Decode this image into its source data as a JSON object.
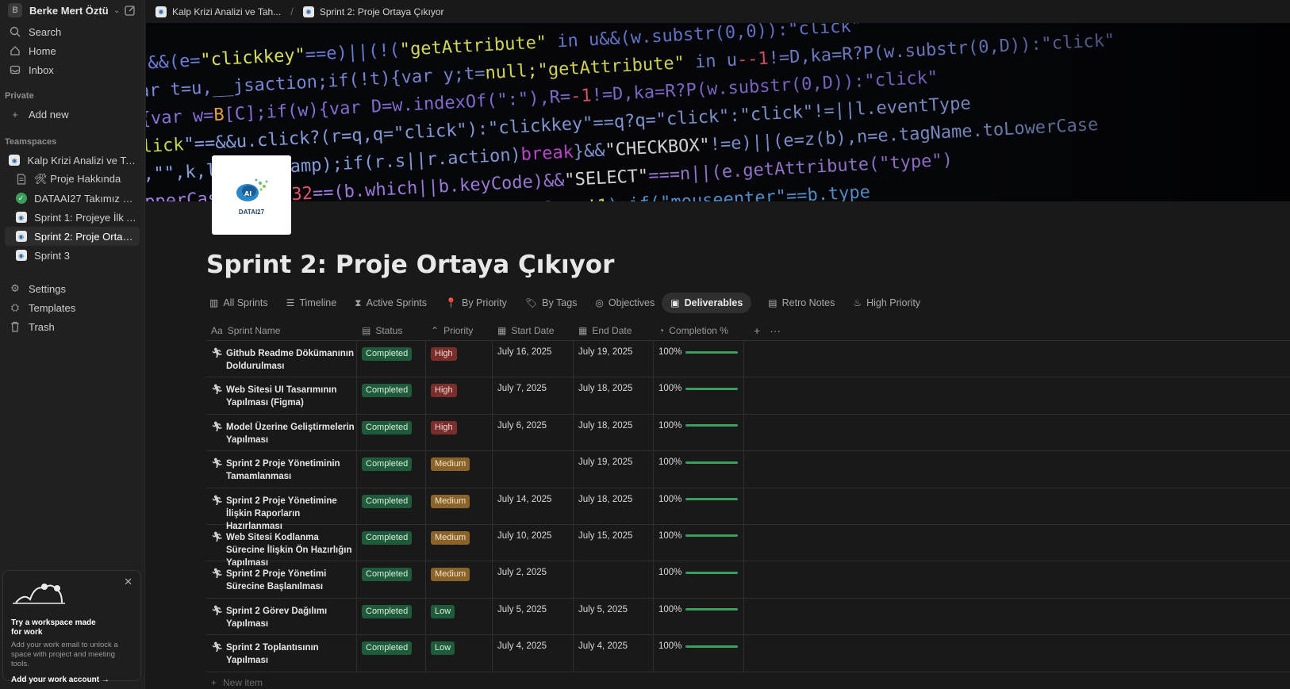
{
  "workspace": {
    "avatar": "B",
    "name": "Berke Mert Öztür..."
  },
  "sidebar": {
    "search": "Search",
    "home": "Home",
    "inbox": "Inbox",
    "private_label": "Private",
    "add_new": "Add new",
    "teamspaces_label": "Teamspaces",
    "teamspace_name": "Kalp Krizi Analizi ve Tahmini",
    "pages": [
      {
        "label": "🛠 Proje Hakkında"
      },
      {
        "label": "DATAAI27 Takımız ve Gör..."
      },
      {
        "label": "Sprint 1: Projeye İlk Adım"
      },
      {
        "label": "Sprint 2: Proje Ortaya Çı..."
      },
      {
        "label": "Sprint 3"
      }
    ],
    "settings": "Settings",
    "templates": "Templates",
    "trash": "Trash"
  },
  "promo": {
    "title": "Try a workspace made for work",
    "desc": "Add your work email to unlock a space with project and meeting tools.",
    "link": "Add your work account"
  },
  "breadcrumbs": [
    "Kalp Krizi Analizi ve Tah...",
    "Sprint 2: Proje Ortaya Çıkıyor"
  ],
  "page": {
    "title": "Sprint 2: Proje Ortaya Çıkıyor",
    "icon_brand": "DATAI27"
  },
  "views": [
    {
      "label": "All Sprints"
    },
    {
      "label": "Timeline"
    },
    {
      "label": "Active Sprints"
    },
    {
      "label": "By Priority"
    },
    {
      "label": "By Tags"
    },
    {
      "label": "Objectives"
    },
    {
      "label": "Deliverables"
    },
    {
      "label": "Retro Notes"
    },
    {
      "label": "High Priority"
    }
  ],
  "table": {
    "headers": {
      "name": "Sprint Name",
      "status": "Status",
      "priority": "Priority",
      "start": "Start Date",
      "end": "End Date",
      "completion": "Completion %"
    },
    "rows": [
      {
        "name": "Github Readme Dökümanının Doldurulması",
        "status": "Completed",
        "priority": "High",
        "start": "July 16, 2025",
        "end": "July 19, 2025",
        "completion": "100%"
      },
      {
        "name": "Web Sitesi UI Tasarımının Yapılması (Figma)",
        "status": "Completed",
        "priority": "High",
        "start": "July 7, 2025",
        "end": "July 18, 2025",
        "completion": "100%"
      },
      {
        "name": "Model Üzerine Geliştirmelerin Yapılması",
        "status": "Completed",
        "priority": "High",
        "start": "July 6, 2025",
        "end": "July 18, 2025",
        "completion": "100%"
      },
      {
        "name": "Sprint 2 Proje Yönetiminin Tamamlanması",
        "status": "Completed",
        "priority": "Medium",
        "start": "",
        "end": "July 19, 2025",
        "completion": "100%"
      },
      {
        "name": "Sprint 2 Proje Yönetimine İlişkin Raporların Hazırlanması",
        "status": "Completed",
        "priority": "Medium",
        "start": "July 14, 2025",
        "end": "July 18, 2025",
        "completion": "100%"
      },
      {
        "name": "Web Sitesi Kodlanma Sürecine İlişkin Ön Hazırlığın Yapılması",
        "status": "Completed",
        "priority": "Medium",
        "start": "July 10, 2025",
        "end": "July 15, 2025",
        "completion": "100%"
      },
      {
        "name": "Sprint 2 Proje Yönetimi Sürecine Başlanılması",
        "status": "Completed",
        "priority": "Medium",
        "start": "July 2, 2025",
        "end": "",
        "completion": "100%"
      },
      {
        "name": "Sprint 2 Görev Dağılımı Yapılması",
        "status": "Completed",
        "priority": "Low",
        "start": "July 5, 2025",
        "end": "July 5, 2025",
        "completion": "100%"
      },
      {
        "name": "Sprint 2 Toplantısının Yapılması",
        "status": "Completed",
        "priority": "Low",
        "start": "July 4, 2025",
        "end": "July 4, 2025",
        "completion": "100%"
      }
    ],
    "new_item": "New item"
  }
}
